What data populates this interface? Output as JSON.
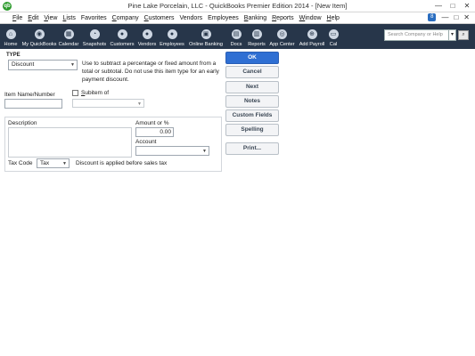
{
  "window": {
    "title": "Pine Lake Porcelain, LLC  - QuickBooks Premier Edition 2014 - [New Item]",
    "logo_text": "qb",
    "controls": [
      "—",
      "□",
      "✕"
    ]
  },
  "menubar": {
    "items": [
      {
        "u": "F",
        "rest": "ile"
      },
      {
        "u": "E",
        "rest": "dit"
      },
      {
        "u": "V",
        "rest": "iew"
      },
      {
        "u": "L",
        "rest": "ists"
      },
      {
        "u": "",
        "rest": "Favorites"
      },
      {
        "u": "C",
        "rest": "ompany"
      },
      {
        "u": "C",
        "rest": "ustomers"
      },
      {
        "u": "",
        "rest": "Vendors"
      },
      {
        "u": "",
        "rest": "Employees"
      },
      {
        "u": "B",
        "rest": "anking"
      },
      {
        "u": "R",
        "rest": "eports"
      },
      {
        "u": "W",
        "rest": "indow"
      },
      {
        "u": "H",
        "rest": "elp"
      }
    ],
    "badge": "8",
    "right_controls": [
      "—",
      "□",
      "✕"
    ]
  },
  "iconbar": {
    "items": [
      {
        "label": "Home",
        "icon": "home-icon",
        "glyph": "⌂"
      },
      {
        "label": "My QuickBooks",
        "icon": "my-quickbooks-icon",
        "glyph": "◉"
      },
      {
        "label": "Calendar",
        "icon": "calendar-icon",
        "glyph": "▦"
      },
      {
        "label": "Snapshots",
        "icon": "snapshots-icon",
        "glyph": "◔"
      },
      {
        "label": "Customers",
        "icon": "customers-icon",
        "glyph": "●"
      },
      {
        "label": "Vendors",
        "icon": "vendors-icon",
        "glyph": "●"
      },
      {
        "label": "Employees",
        "icon": "employees-icon",
        "glyph": "●"
      },
      {
        "label": "Online Banking",
        "icon": "online-banking-icon",
        "glyph": "▣"
      },
      {
        "label": "Docs",
        "icon": "docs-icon",
        "glyph": "▤"
      },
      {
        "label": "Reports",
        "icon": "reports-icon",
        "glyph": "▥"
      },
      {
        "label": "App Center",
        "icon": "app-center-icon",
        "glyph": "◎"
      },
      {
        "label": "Add Payroll",
        "icon": "add-payroll-icon",
        "glyph": "⊕"
      },
      {
        "label": "Cal",
        "icon": "credit-card-icon",
        "glyph": "▭"
      }
    ],
    "search_placeholder": "Search Company or Help",
    "search_go": "▾",
    "search_button": "⌕"
  },
  "form": {
    "type_label": "TYPE",
    "type_value": "Discount",
    "type_description": "Use to subtract a percentage or fixed amount from a total or subtotal. Do not use this item type for an early payment discount.",
    "item_name_label": "Item Name/Number",
    "item_name_value": "",
    "subitem_label_u": "S",
    "subitem_label_rest": "ubitem of",
    "description_label": "Description",
    "amount_label": "Amount or %",
    "amount_value": "0.00",
    "account_label": "Account",
    "account_value": "",
    "tax_code_label": "Tax Code",
    "tax_code_value": "Tax",
    "tax_note": "Discount is applied before sales tax"
  },
  "buttons": {
    "ok": "OK",
    "cancel": "Cancel",
    "next": "Next",
    "notes": "Notes",
    "custom_fields": "Custom Fields",
    "spelling": "Spelling",
    "print": "Print..."
  },
  "colors": {
    "iconbar_bg": "#27364a",
    "primary_button": "#2f6fd3",
    "logo": "#2c9b2c"
  }
}
